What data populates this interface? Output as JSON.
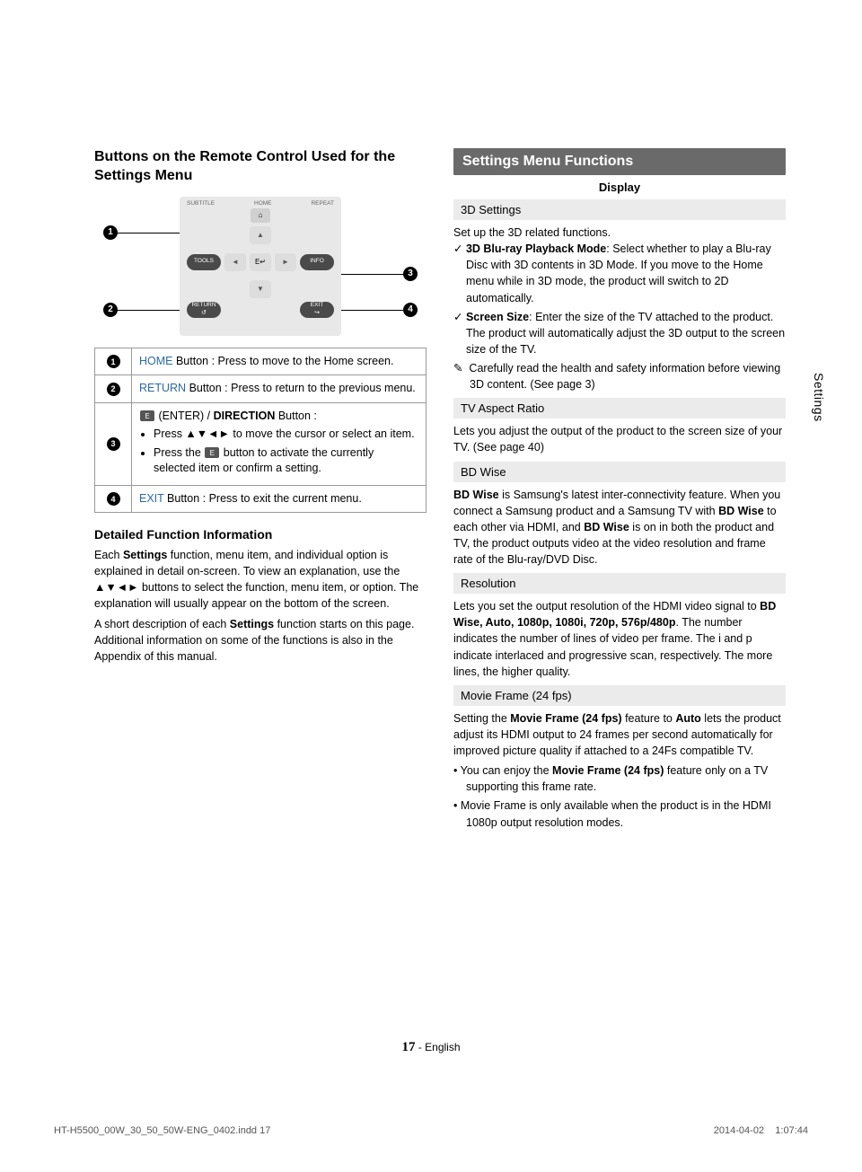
{
  "side_tab": "Settings",
  "left": {
    "title": "Buttons on the Remote Control Used for the Settings Menu",
    "remote": {
      "top": {
        "subtitle": "SUBTITLE",
        "home": "HOME",
        "repeat": "REPEAT"
      },
      "tools": "TOOLS",
      "info": "INFO",
      "return": "RETURN",
      "exit": "EXIT",
      "home_icon": "⌂",
      "enter_icon": "E↵"
    },
    "callouts": {
      "c1": "1",
      "c2": "2",
      "c3": "3",
      "c4": "4"
    },
    "table": {
      "r1": {
        "label": "HOME",
        "text": " Button : Press to move to the Home screen."
      },
      "r2": {
        "label": "RETURN",
        "text": " Button : Press to return to the previous menu."
      },
      "r3": {
        "enter_label": "E",
        "title_a": " (ENTER) / ",
        "title_b": "DIRECTION",
        "title_c": " Button :",
        "li1a": "Press ▲▼◄► to move the cursor or select an item.",
        "li2a": "Press the ",
        "li2b": " button to activate the currently selected item or confirm a setting."
      },
      "r4": {
        "label": "EXIT",
        "text": " Button : Press to exit the current menu."
      }
    },
    "detailed": {
      "heading": "Detailed Function Information",
      "p1a": "Each ",
      "p1b": "Settings",
      "p1c": " function, menu item, and individual option is explained in detail on-screen. To view an explanation, use the ▲▼◄► buttons to select the function, menu item, or option. The explanation will usually appear on the bottom of the screen.",
      "p2a": "A short description of each ",
      "p2b": "Settings",
      "p2c": " function starts on this page. Additional information on some of the functions is also in the Appendix of this manual."
    }
  },
  "right": {
    "header": "Settings Menu Functions",
    "display_label": "Display",
    "s3d": {
      "head": "3D Settings",
      "intro": "Set up the 3D related functions.",
      "i1a": "3D Blu-ray Playback Mode",
      "i1b": ": Select whether to play a Blu-ray Disc with 3D contents in 3D Mode. If you move to the Home menu while in 3D mode, the product will switch to 2D automatically.",
      "i2a": "Screen Size",
      "i2b": ": Enter the size of the TV attached to the product. The product will automatically adjust the 3D output to the screen size of the TV.",
      "note": "Carefully read the health and safety information before viewing 3D content. (See page 3)"
    },
    "tv": {
      "head": "TV Aspect Ratio",
      "text": "Lets you adjust the output of the product to the screen size of your TV. (See page 40)"
    },
    "bdw": {
      "head": "BD Wise",
      "t1": "BD Wise",
      "t2": " is Samsung's latest inter-connectivity feature. When you connect a Samsung product and a Samsung TV with ",
      "t3": "BD Wise",
      "t4": " to each other via HDMI, and ",
      "t5": "BD Wise",
      "t6": " is on in both the product and TV, the product outputs video at the video resolution and frame rate of the Blu-ray/DVD Disc."
    },
    "res": {
      "head": "Resolution",
      "t1": "Lets you set the output resolution of the HDMI video signal to ",
      "t2": "BD Wise, Auto, 1080p, 1080i, 720p, 576p/480p",
      "t3": ". The number indicates the number of lines of video per frame. The i and p indicate interlaced and progressive scan, respectively. The more lines, the higher quality."
    },
    "mf": {
      "head": "Movie Frame (24 fps)",
      "t1": "Setting the ",
      "t2": "Movie Frame (24 fps)",
      "t3": " feature to ",
      "t4": "Auto",
      "t5": " lets the product adjust its HDMI output to 24 frames per second automatically for improved picture quality if attached to a 24Fs compatible TV.",
      "b1a": "You can enjoy the ",
      "b1b": "Movie Frame (24 fps)",
      "b1c": " feature only on a TV supporting this frame rate.",
      "b2": "Movie Frame is only available when the product is in the HDMI 1080p output resolution modes."
    }
  },
  "footer": {
    "page_num": "17",
    "page_lang": " - English",
    "file": "HT-H5500_00W_30_50_50W-ENG_0402.indd   17",
    "date": "2014-04-02",
    "time": "1:07:44"
  }
}
